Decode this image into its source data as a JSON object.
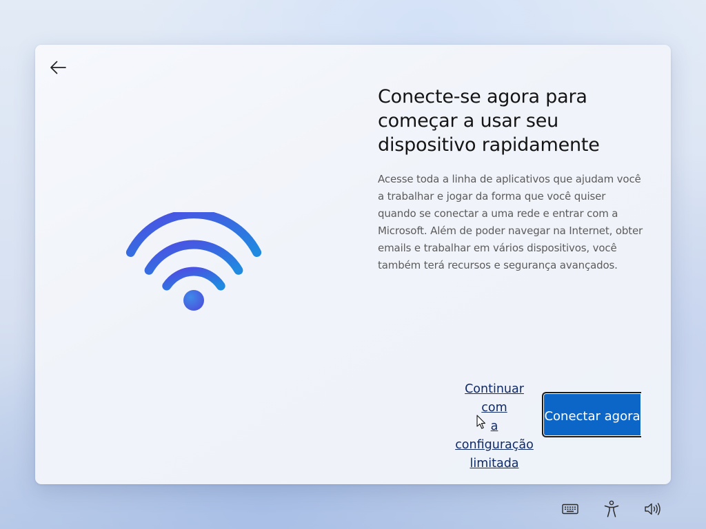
{
  "setup_page": {
    "title": "Conecte-se agora para começar a usar seu dispositivo rapidamente",
    "description": "Acesse toda a linha de aplicativos que ajudam você a trabalhar e jogar da forma que você quiser quando se conectar a uma rede e entrar com a Microsoft. Além de poder navegar na Internet, obter emails e trabalhar em vários dispositivos, você também terá recursos e segurança avançados.",
    "illustration": "wifi-icon"
  },
  "navigation": {
    "back_icon": "back-arrow-icon"
  },
  "actions": {
    "limited_setup_label": "Continuar com a configuração limitada",
    "connect_label": "Conectar agora"
  },
  "tray": {
    "icons": [
      "keyboard-icon",
      "accessibility-icon",
      "volume-icon"
    ]
  },
  "colors": {
    "accent": "#0b66c8",
    "link": "#0f2a66",
    "wifi_gradient_start": "#4c4fe0",
    "wifi_gradient_end": "#1d8ce0"
  }
}
